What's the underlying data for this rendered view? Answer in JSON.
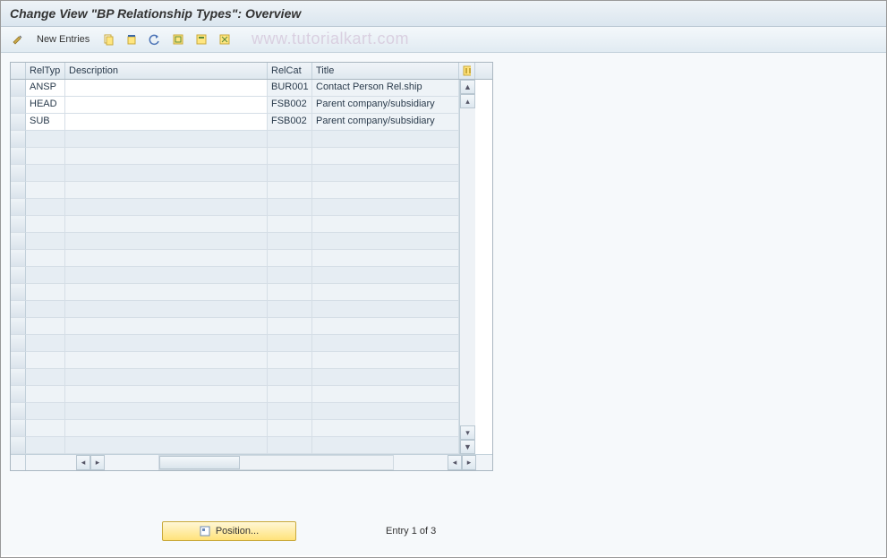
{
  "header": {
    "title": "Change View \"BP Relationship Types\": Overview"
  },
  "toolbar": {
    "new_entries_label": "New Entries"
  },
  "watermark": "www.tutorialkart.com",
  "table": {
    "columns": {
      "reltyp": "RelTyp",
      "description": "Description",
      "relcat": "RelCat",
      "title": "Title"
    },
    "rows": [
      {
        "reltyp": "ANSP",
        "description": "",
        "relcat": "BUR001",
        "title": "Contact Person Rel.ship"
      },
      {
        "reltyp": "HEAD",
        "description": "",
        "relcat": "FSB002",
        "title": "Parent company/subsidiary"
      },
      {
        "reltyp": "SUB",
        "description": "",
        "relcat": "FSB002",
        "title": "Parent company/subsidiary"
      }
    ],
    "empty_row_count": 19
  },
  "footer": {
    "position_label": "Position...",
    "entry_text": "Entry 1 of 3"
  }
}
